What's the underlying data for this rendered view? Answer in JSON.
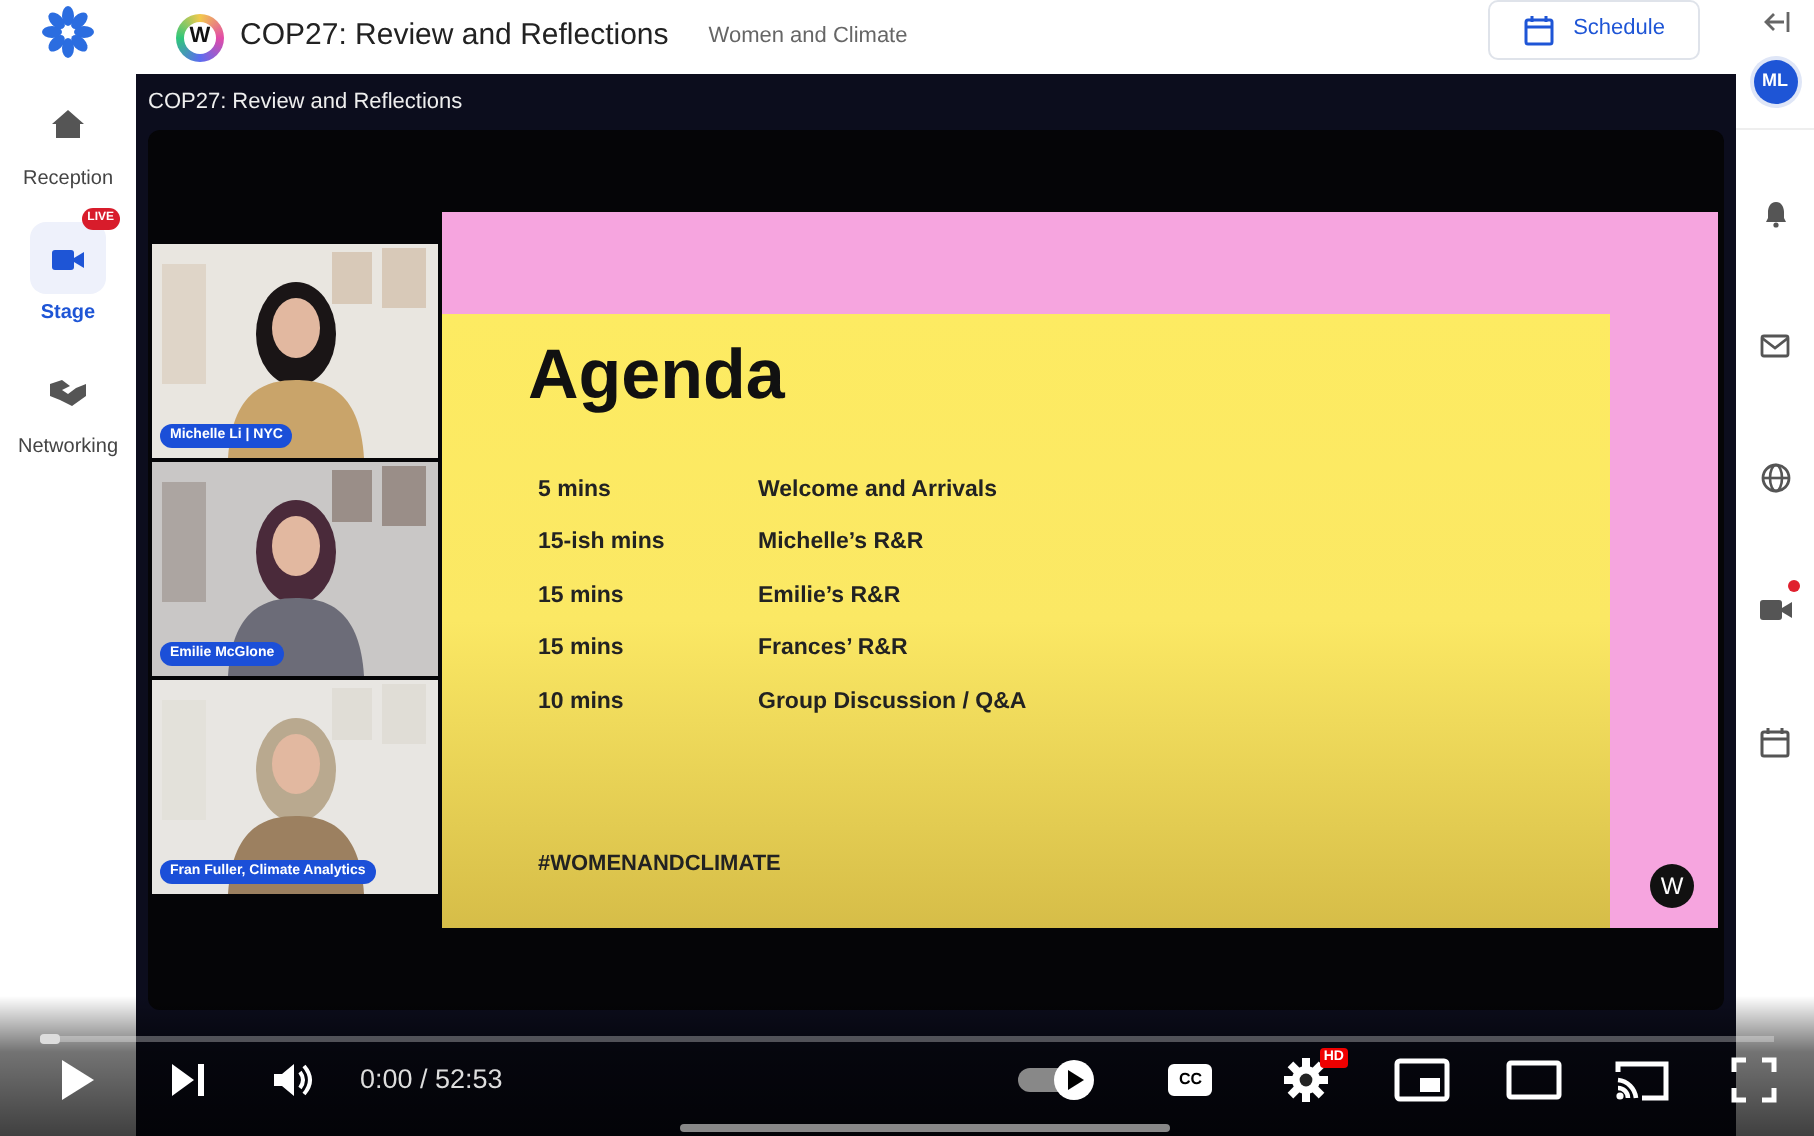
{
  "sidebar": {
    "items": [
      {
        "label": "Reception",
        "selected": false
      },
      {
        "label": "Stage",
        "selected": true,
        "badge": "LIVE"
      },
      {
        "label": "Networking",
        "selected": false
      }
    ]
  },
  "header": {
    "logo_text": "W",
    "title": "COP27: Review and Reflections",
    "subtitle": "Women and Climate",
    "schedule_button": "Schedule"
  },
  "right_rail": {
    "avatar": "ML",
    "items": [
      {
        "alert": false
      },
      {
        "alert": false
      },
      {
        "alert": false
      },
      {
        "alert": true
      },
      {
        "alert": false
      }
    ]
  },
  "stage": {
    "title": "COP27: Review and Reflections",
    "speakers": [
      {
        "name": "Michelle Li | NYC"
      },
      {
        "name": "Emilie McGlone"
      },
      {
        "name": "Fran Fuller, Climate Analytics"
      }
    ],
    "slide": {
      "heading": "Agenda",
      "rows": [
        {
          "time": "5 mins",
          "item": "Welcome and Arrivals"
        },
        {
          "time": "15-ish mins",
          "item": "Michelle’s R&R"
        },
        {
          "time": "15 mins",
          "item": "Emilie’s R&R"
        },
        {
          "time": "15 mins",
          "item": "Frances’ R&R"
        },
        {
          "time": "10 mins",
          "item": "Group Discussion / Q&A"
        }
      ],
      "hashtag": "#WOMENANDCLIMATE",
      "logo_text": "W"
    }
  },
  "player": {
    "progress": {
      "level": 0.0
    },
    "time": "0:00 / 52:53",
    "autoplay": true,
    "cc": "CC",
    "hd_badge": "HD"
  }
}
